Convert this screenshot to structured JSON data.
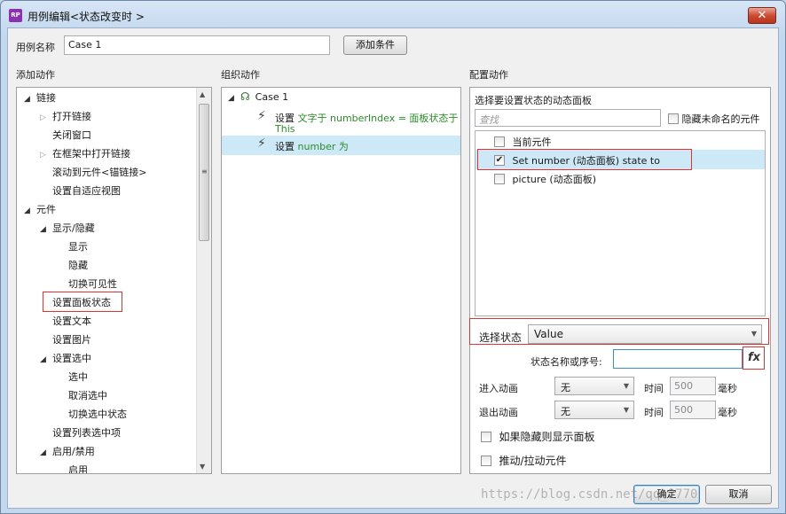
{
  "window": {
    "title": "用例编辑<状态改变时 >",
    "app_icon_text": "RP",
    "close_glyph": "✕"
  },
  "case_name": {
    "label": "用例名称",
    "value": "Case 1"
  },
  "add_condition_button": "添加条件",
  "add_actions": {
    "heading": "添加动作",
    "items": [
      {
        "label": "链接",
        "expand": "down"
      },
      {
        "label": "打开链接",
        "expand": "right"
      },
      {
        "label": "关闭窗口",
        "expand": "none"
      },
      {
        "label": "在框架中打开链接",
        "expand": "right"
      },
      {
        "label": "滚动到元件<锚链接>",
        "expand": "none"
      },
      {
        "label": "设置自适应视图",
        "expand": "none"
      },
      {
        "label": "元件",
        "expand": "down"
      },
      {
        "label": "显示/隐藏",
        "expand": "down"
      },
      {
        "label": "显示",
        "expand": "none"
      },
      {
        "label": "隐藏",
        "expand": "none"
      },
      {
        "label": "切换可见性",
        "expand": "none"
      },
      {
        "label": "设置面板状态",
        "expand": "none",
        "highlighted": true
      },
      {
        "label": "设置文本",
        "expand": "none"
      },
      {
        "label": "设置图片",
        "expand": "none"
      },
      {
        "label": "设置选中",
        "expand": "down"
      },
      {
        "label": "选中",
        "expand": "none"
      },
      {
        "label": "取消选中",
        "expand": "none"
      },
      {
        "label": "切换选中状态",
        "expand": "none"
      },
      {
        "label": "设置列表选中项",
        "expand": "none"
      },
      {
        "label": "启用/禁用",
        "expand": "down"
      },
      {
        "label": "启用",
        "expand": "none"
      }
    ]
  },
  "organize_actions": {
    "heading": "组织动作",
    "case_label": "Case 1",
    "actions": [
      {
        "prefix": "设置",
        "detail": "文字于 numberIndex = 面板状态于",
        "detail2": "This"
      },
      {
        "prefix": "设置",
        "detail": "number 为",
        "detail2": ""
      }
    ]
  },
  "config_actions": {
    "heading": "配置动作",
    "panel_select_label": "选择要设置状态的动态面板",
    "search_placeholder": "查找",
    "hide_unnamed_label": "隐藏未命名的元件",
    "widgets": [
      {
        "label": "当前元件",
        "checked": false
      },
      {
        "label": "Set number (动态面板) state to",
        "checked": true
      },
      {
        "label": "picture (动态面板)",
        "checked": false
      }
    ],
    "select_state_label": "选择状态",
    "select_state_value": "Value",
    "state_name_label": "状态名称或序号:",
    "state_name_value": "",
    "fx_label": "fx",
    "enter_anim_label": "进入动画",
    "enter_anim_value": "无",
    "exit_anim_label": "退出动画",
    "exit_anim_value": "无",
    "time_label": "时间",
    "enter_time_value": "500",
    "exit_time_value": "500",
    "ms_label": "毫秒",
    "show_if_hidden_label": "如果隐藏则显示面板",
    "push_pull_label": "推动/拉动元件"
  },
  "ok_button": "确定",
  "cancel_button": "取消",
  "watermark": "https://blog.csdn.net/qq_2770"
}
